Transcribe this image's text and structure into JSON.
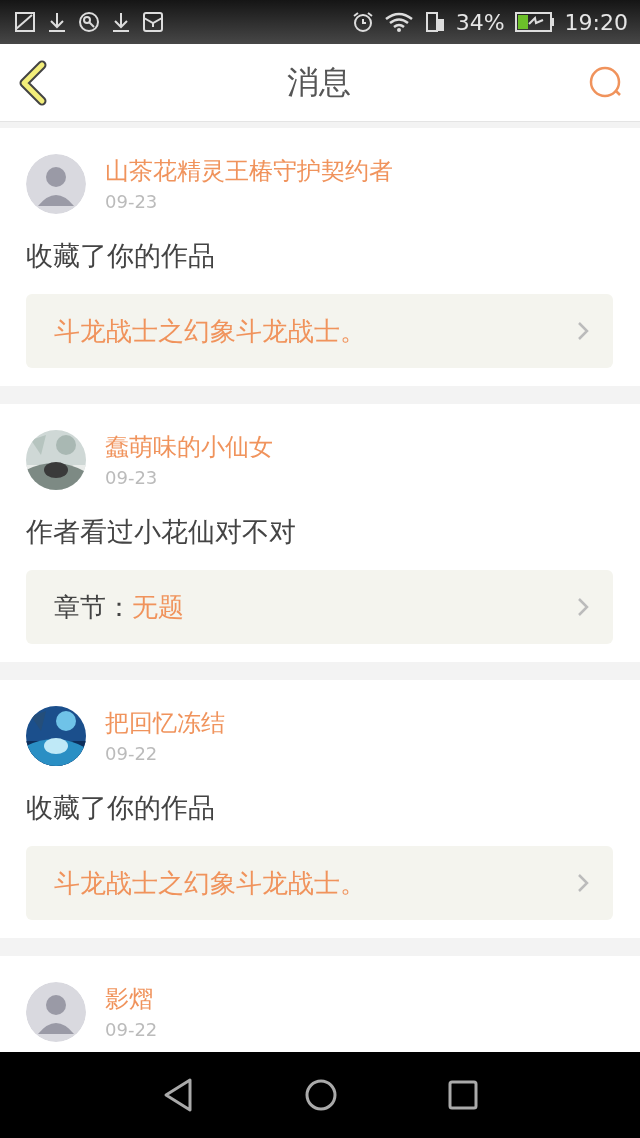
{
  "status_bar": {
    "battery": "34%",
    "time": "19:20"
  },
  "header": {
    "title": "消息"
  },
  "messages": [
    {
      "user": "山茶花精灵王椿守护契约者",
      "date": "09-23",
      "avatar": {
        "kind": "silhouette"
      },
      "text": "收藏了你的作品",
      "target": {
        "kind": "work",
        "title": "斗龙战士之幻象斗龙战士。"
      }
    },
    {
      "user": "蠢萌味的小仙女",
      "date": "09-23",
      "text": "作者看过小花仙对不对",
      "target": {
        "kind": "chapter",
        "label": "章节：",
        "title": "无题"
      }
    },
    {
      "user": "把回忆冻结",
      "date": "09-22",
      "text": "收藏了你的作品",
      "target": {
        "kind": "work",
        "title": "斗龙战士之幻象斗龙战士。"
      }
    },
    {
      "user": "影熠",
      "date": "09-22",
      "avatar": {
        "kind": "silhouette"
      }
    }
  ]
}
